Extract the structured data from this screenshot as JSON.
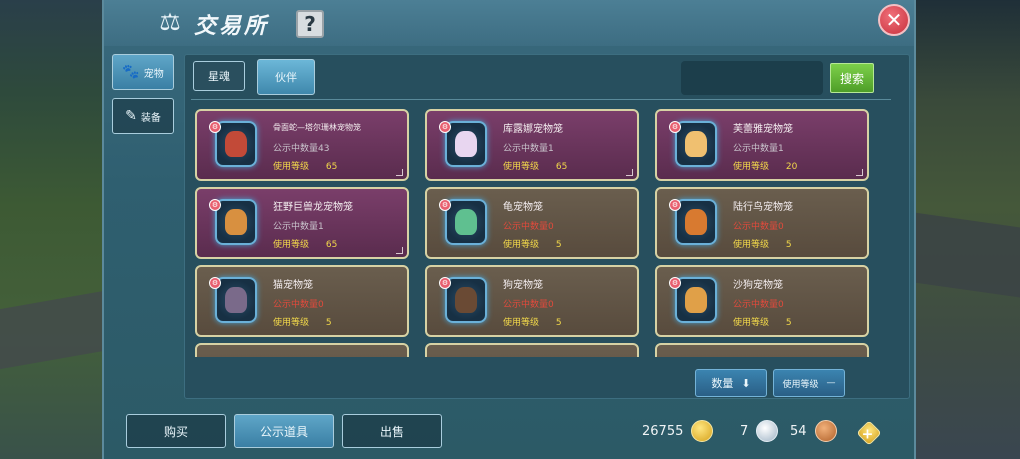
{
  "header": {
    "title": "交易所",
    "help_label": "?",
    "close_label": "✕",
    "title_icon": "scale-icon"
  },
  "side_tabs": [
    {
      "label": "宠物",
      "icon": "paw-icon",
      "active": true
    },
    {
      "label": "装备",
      "icon": "edit-icon",
      "active": false
    }
  ],
  "sub_tabs": [
    {
      "label": "星魂",
      "active": false
    },
    {
      "label": "伙伴",
      "active": true
    }
  ],
  "search": {
    "value": "",
    "button_label": "搜索"
  },
  "cards": [
    {
      "name": "骨面蛇—塔尔珊林宠物笼",
      "qty_label": "公示中数量43",
      "qty_zero": false,
      "level_label": "使用等级",
      "level": "65",
      "theme": "purple",
      "art_color": "#c24a38"
    },
    {
      "name": "库露娜宠物笼",
      "qty_label": "公示中数量1",
      "qty_zero": false,
      "level_label": "使用等级",
      "level": "65",
      "theme": "purple",
      "art_color": "#e8d6f0"
    },
    {
      "name": "芙蕾雅宠物笼",
      "qty_label": "公示中数量1",
      "qty_zero": false,
      "level_label": "使用等级",
      "level": "20",
      "theme": "purple",
      "art_color": "#f0c070"
    },
    {
      "name": "狂野巨兽龙宠物笼",
      "qty_label": "公示中数量1",
      "qty_zero": false,
      "level_label": "使用等级",
      "level": "65",
      "theme": "purple",
      "art_color": "#d89040"
    },
    {
      "name": "龟宠物笼",
      "qty_label": "公示中数量0",
      "qty_zero": true,
      "level_label": "使用等级",
      "level": "5",
      "theme": "brown",
      "art_color": "#5fc090"
    },
    {
      "name": "陆行鸟宠物笼",
      "qty_label": "公示中数量0",
      "qty_zero": true,
      "level_label": "使用等级",
      "level": "5",
      "theme": "brown",
      "art_color": "#d87a30"
    },
    {
      "name": "猫宠物笼",
      "qty_label": "公示中数量0",
      "qty_zero": true,
      "level_label": "使用等级",
      "level": "5",
      "theme": "brown",
      "art_color": "#7a6a8a"
    },
    {
      "name": "狗宠物笼",
      "qty_label": "公示中数量0",
      "qty_zero": true,
      "level_label": "使用等级",
      "level": "5",
      "theme": "brown",
      "art_color": "#6a4a34"
    },
    {
      "name": "沙狗宠物笼",
      "qty_label": "公示中数量0",
      "qty_zero": true,
      "level_label": "使用等级",
      "level": "5",
      "theme": "brown",
      "art_color": "#e0a048"
    },
    {
      "name": "",
      "qty_label": "",
      "qty_zero": false,
      "level_label": "",
      "level": "",
      "theme": "brown",
      "art_color": "#6a5e4e"
    },
    {
      "name": "",
      "qty_label": "",
      "qty_zero": false,
      "level_label": "",
      "level": "",
      "theme": "brown",
      "art_color": "#6a5e4e"
    },
    {
      "name": "",
      "qty_label": "",
      "qty_zero": false,
      "level_label": "",
      "level": "",
      "theme": "brown",
      "art_color": "#6a5e4e"
    }
  ],
  "sort": {
    "qty_label": "数量",
    "qty_icon": "arrow-down-icon",
    "level_label": "使用等级",
    "level_icon": "minus-icon"
  },
  "bottom_tabs": [
    {
      "label": "购买",
      "active": false
    },
    {
      "label": "公示道具",
      "active": true
    },
    {
      "label": "出售",
      "active": false
    }
  ],
  "currency": {
    "gold": "26755",
    "silver": "7",
    "bronze": "54"
  }
}
